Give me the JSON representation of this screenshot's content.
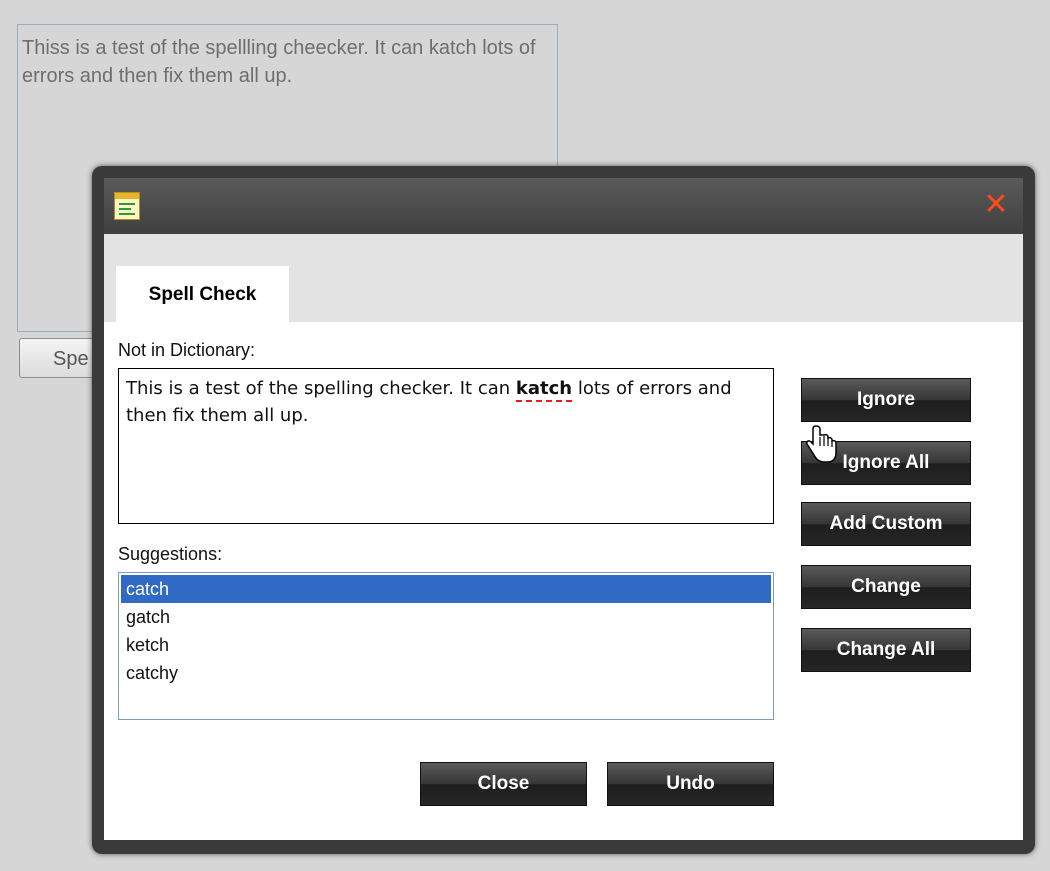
{
  "background": {
    "textarea_text": "Thiss is a test of the spellling cheecker. It can katch lots of errors and then fix them all up.",
    "button_label": "Spe"
  },
  "dialog": {
    "tab_label": "Spell Check",
    "not_in_dictionary_label": "Not in Dictionary:",
    "sentence_before": "This is a test of the spelling checker. It can ",
    "misspelled_word": "katch",
    "sentence_after": " lots of errors and then fix them all up.",
    "suggestions_label": "Suggestions:",
    "suggestions": [
      "catch",
      "gatch",
      "ketch",
      "catchy"
    ],
    "selected_suggestion": "catch",
    "buttons": {
      "ignore": "Ignore",
      "ignore_all": "Ignore All",
      "add_custom": "Add Custom",
      "change": "Change",
      "change_all": "Change All",
      "close": "Close",
      "undo": "Undo"
    },
    "close_glyph": "✕",
    "icons": {
      "window": "window-app-icon",
      "close": "close-icon",
      "cursor": "hand-pointer-cursor"
    },
    "colors": {
      "close_icon": "#ff4a1a",
      "selection": "#316ac5",
      "misspelling_underline": "#e0201c"
    }
  }
}
